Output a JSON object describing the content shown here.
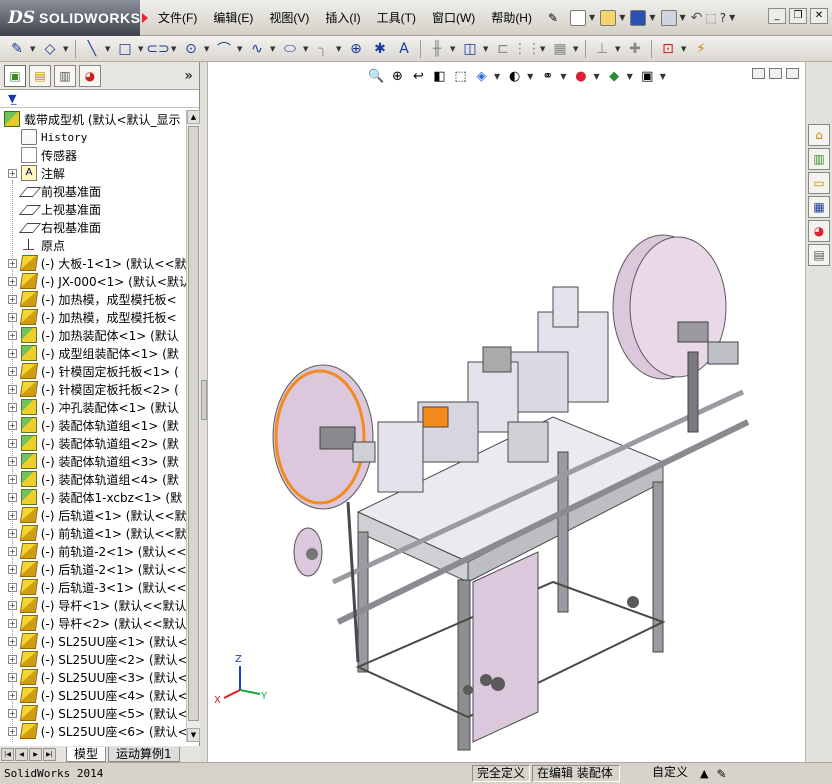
{
  "app": {
    "brand": "SOLIDWORKS",
    "brand_prefix": "DS"
  },
  "menu": [
    {
      "label": "文件(F)"
    },
    {
      "label": "编辑(E)"
    },
    {
      "label": "视图(V)"
    },
    {
      "label": "插入(I)"
    },
    {
      "label": "工具(T)"
    },
    {
      "label": "窗口(W)"
    },
    {
      "label": "帮助(H)"
    }
  ],
  "feature_manager": {
    "filter_icon": "filter-icon",
    "more_label": "»",
    "root": {
      "label": "载带成型机  (默认<默认_显示"
    },
    "nodes": [
      {
        "label": "History",
        "icon": "history-icon",
        "expandable": false
      },
      {
        "label": "传感器",
        "icon": "sensor-icon",
        "expandable": false
      },
      {
        "label": "注解",
        "icon": "annotation-icon",
        "expandable": true
      },
      {
        "label": "前视基准面",
        "icon": "plane-icon",
        "expandable": false
      },
      {
        "label": "上视基准面",
        "icon": "plane-icon",
        "expandable": false
      },
      {
        "label": "右视基准面",
        "icon": "plane-icon",
        "expandable": false
      },
      {
        "label": "原点",
        "icon": "origin-icon",
        "expandable": false
      },
      {
        "label": "(-) 大板-1<1> (默认<<默",
        "icon": "part-icon",
        "expandable": true
      },
      {
        "label": "(-) JX-000<1> (默认<默认",
        "icon": "part-icon",
        "expandable": true
      },
      {
        "label": "(-) 加热模，成型模托板<",
        "icon": "part-icon",
        "expandable": true
      },
      {
        "label": "(-) 加热模，成型模托板<",
        "icon": "part-icon",
        "expandable": true
      },
      {
        "label": "(-) 加热装配体<1> (默认",
        "icon": "assembly-icon",
        "expandable": true
      },
      {
        "label": "(-) 成型组装配体<1> (默",
        "icon": "assembly-icon",
        "expandable": true
      },
      {
        "label": "(-) 针模固定板托板<1> (",
        "icon": "part-icon",
        "expandable": true
      },
      {
        "label": "(-) 针模固定板托板<2> (",
        "icon": "part-icon",
        "expandable": true
      },
      {
        "label": "(-) 冲孔装配体<1> (默认",
        "icon": "assembly-icon",
        "expandable": true
      },
      {
        "label": "(-) 装配体轨道组<1> (默",
        "icon": "assembly-icon",
        "expandable": true
      },
      {
        "label": "(-) 装配体轨道组<2> (默",
        "icon": "assembly-icon",
        "expandable": true
      },
      {
        "label": "(-) 装配体轨道组<3> (默",
        "icon": "assembly-icon",
        "expandable": true
      },
      {
        "label": "(-) 装配体轨道组<4> (默",
        "icon": "assembly-icon",
        "expandable": true
      },
      {
        "label": "(-) 装配体1-xcbz<1> (默",
        "icon": "assembly-icon",
        "expandable": true
      },
      {
        "label": "(-) 后轨道<1> (默认<<默",
        "icon": "part-icon",
        "expandable": true
      },
      {
        "label": "(-) 前轨道<1> (默认<<默",
        "icon": "part-icon",
        "expandable": true
      },
      {
        "label": "(-) 前轨道-2<1> (默认<<",
        "icon": "part-icon",
        "expandable": true
      },
      {
        "label": "(-) 后轨道-2<1> (默认<<",
        "icon": "part-icon",
        "expandable": true
      },
      {
        "label": "(-) 后轨道-3<1> (默认<<",
        "icon": "part-icon",
        "expandable": true
      },
      {
        "label": "(-) 导杆<1> (默认<<默认",
        "icon": "part-icon",
        "expandable": true
      },
      {
        "label": "(-) 导杆<2> (默认<<默认",
        "icon": "part-icon",
        "expandable": true
      },
      {
        "label": "(-) SL25UU座<1> (默认<<",
        "icon": "part-icon",
        "expandable": true
      },
      {
        "label": "(-) SL25UU座<2> (默认<<",
        "icon": "part-icon",
        "expandable": true
      },
      {
        "label": "(-) SL25UU座<3> (默认<<",
        "icon": "part-icon",
        "expandable": true
      },
      {
        "label": "(-) SL25UU座<4> (默认<<",
        "icon": "part-icon",
        "expandable": true
      },
      {
        "label": "(-) SL25UU座<5> (默认<<",
        "icon": "part-icon",
        "expandable": true
      },
      {
        "label": "(-) SL25UU座<6> (默认<<",
        "icon": "part-icon",
        "expandable": true
      }
    ]
  },
  "bottom_tabs": [
    {
      "label": "模型",
      "active": true
    },
    {
      "label": "运动算例1",
      "active": false
    }
  ],
  "triad": {
    "z": "Z",
    "x": "X",
    "y": "Y"
  },
  "status_bar": {
    "app_version": "SolidWorks 2014",
    "state": "完全定义",
    "editing": "在编辑 装配体",
    "units": "自定义"
  },
  "colors": {
    "reel": "#dcc8dc",
    "selection": "#f28a1e",
    "frame": "#6a6a6a"
  }
}
